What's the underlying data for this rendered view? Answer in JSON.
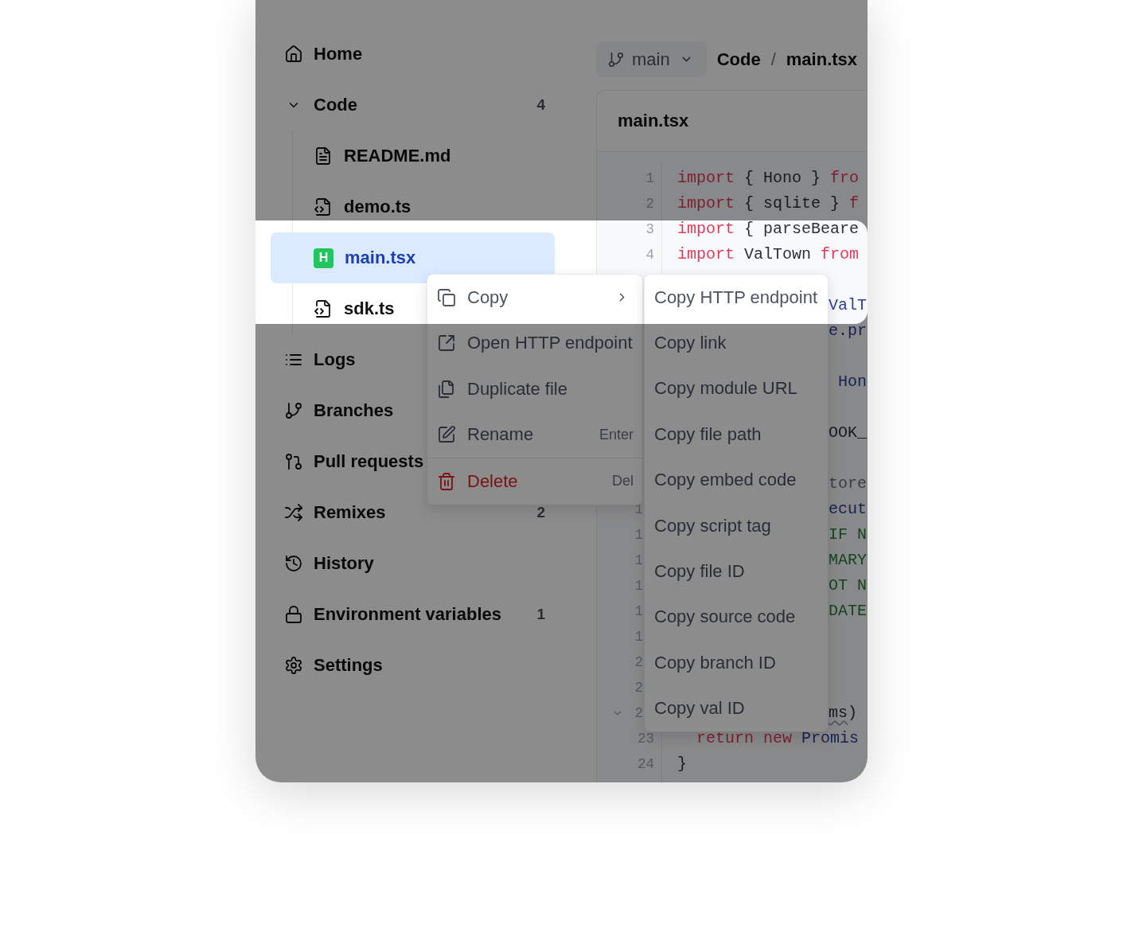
{
  "overlay": {
    "dimmed": true
  },
  "sidebar": {
    "items": [
      {
        "label": "Home",
        "selected": false
      },
      {
        "label": "Code",
        "count": "4",
        "expanded": true,
        "selected": false,
        "children": [
          {
            "label": "README.md",
            "kind": "markdown",
            "selected": false
          },
          {
            "label": "demo.ts",
            "kind": "script",
            "selected": false
          },
          {
            "label": "main.tsx",
            "kind": "http",
            "badge": "H",
            "selected": true
          },
          {
            "label": "sdk.ts",
            "kind": "script",
            "selected": false
          }
        ]
      },
      {
        "label": "Logs",
        "selected": false
      },
      {
        "label": "Branches",
        "selected": false
      },
      {
        "label": "Pull requests",
        "selected": false
      },
      {
        "label": "Remixes",
        "count": "2",
        "selected": false
      },
      {
        "label": "History",
        "selected": false
      },
      {
        "label": "Environment variables",
        "count": "1",
        "selected": false
      },
      {
        "label": "Settings",
        "selected": false
      }
    ]
  },
  "branch_selector": {
    "value": "main"
  },
  "breadcrumb": {
    "items": [
      "Code",
      "main.tsx"
    ],
    "separator": "/"
  },
  "editor": {
    "title": "main.tsx",
    "lines": [
      {
        "kind": "full",
        "number": "1",
        "tokens": [
          {
            "text": "import",
            "kind": "keyword"
          },
          {
            "text": " { Hono } ",
            "kind": "plain"
          },
          {
            "text": "fro",
            "kind": "keyword"
          }
        ]
      },
      {
        "kind": "full",
        "number": "2",
        "tokens": [
          {
            "text": "import",
            "kind": "keyword"
          },
          {
            "text": " { sqlite } ",
            "kind": "plain"
          },
          {
            "text": "f",
            "kind": "keyword"
          }
        ]
      },
      {
        "kind": "full",
        "number": "3",
        "tokens": [
          {
            "text": "import",
            "kind": "keyword"
          },
          {
            "text": " { parseBeare",
            "kind": "plain"
          }
        ]
      },
      {
        "kind": "full",
        "number": "4",
        "tokens": [
          {
            "text": "import",
            "kind": "keyword"
          },
          {
            "text": " ValTown ",
            "kind": "plain"
          },
          {
            "text": "from",
            "kind": "keyword"
          }
        ]
      },
      {
        "kind": "covered"
      },
      {
        "kind": "covered",
        "tokens": [
          {
            "text": "ValT",
            "kind": "ident"
          }
        ]
      },
      {
        "kind": "covered",
        "tokens": [
          {
            "text": "e.pr",
            "kind": "ident"
          }
        ]
      },
      {
        "kind": "covered"
      },
      {
        "kind": "covered",
        "tokens": [
          {
            "text": " Hon",
            "kind": "ident"
          }
        ]
      },
      {
        "kind": "covered"
      },
      {
        "kind": "covered",
        "tokens": [
          {
            "text": "OOK_",
            "kind": "plain"
          }
        ]
      },
      {
        "kind": "covered"
      },
      {
        "kind": "covered",
        "tokens": [
          {
            "text": "tore",
            "kind": "comment"
          }
        ]
      },
      {
        "kind": "covered",
        "number": "1",
        "tokens": [
          {
            "text": "ecut",
            "kind": "ident"
          }
        ]
      },
      {
        "kind": "covered",
        "number": "1",
        "tokens": [
          {
            "text": "IF N",
            "kind": "string"
          }
        ]
      },
      {
        "kind": "covered",
        "number": "1",
        "tokens": [
          {
            "text": "MARY",
            "kind": "string"
          }
        ]
      },
      {
        "kind": "covered",
        "number": "1",
        "tokens": [
          {
            "text": "OT N",
            "kind": "string"
          }
        ]
      },
      {
        "kind": "covered",
        "number": "1",
        "tokens": [
          {
            "text": "DATE",
            "kind": "string"
          }
        ]
      },
      {
        "kind": "covered",
        "number": "1"
      },
      {
        "kind": "covered",
        "number": "2"
      },
      {
        "kind": "covered",
        "number": "2"
      },
      {
        "kind": "covered",
        "number": "2",
        "expanded": true,
        "tokens": [
          {
            "text": "ms",
            "kind": "flagged"
          },
          {
            "text": ")",
            "kind": "plain"
          }
        ]
      },
      {
        "kind": "full",
        "number": "23",
        "tokens": [
          {
            "text": "  return",
            "kind": "keyword"
          },
          {
            "text": " new",
            "kind": "keyword"
          },
          {
            "text": " Promis",
            "kind": "ident"
          }
        ]
      },
      {
        "kind": "full",
        "number": "24",
        "tokens": [
          {
            "text": "}",
            "kind": "plain"
          }
        ]
      }
    ]
  },
  "context_menu": {
    "sections": [
      {
        "items": [
          {
            "label": "Copy",
            "kind": "normal",
            "has_submenu": true
          },
          {
            "label": "Open HTTP endpoint",
            "kind": "normal",
            "has_submenu": false
          },
          {
            "label": "Duplicate file",
            "kind": "normal",
            "has_submenu": false
          },
          {
            "label": "Rename",
            "kind": "normal",
            "shortcut": "Enter",
            "has_submenu": false
          }
        ]
      },
      {
        "items": [
          {
            "label": "Delete",
            "kind": "danger",
            "shortcut": "Del",
            "has_submenu": false
          }
        ]
      }
    ]
  },
  "submenu": {
    "items": [
      "Copy HTTP endpoint",
      "Copy link",
      "Copy module URL",
      "Copy file path",
      "Copy embed code",
      "Copy script tag",
      "Copy file ID",
      "Copy source code",
      "Copy branch ID",
      "Copy val ID"
    ]
  }
}
